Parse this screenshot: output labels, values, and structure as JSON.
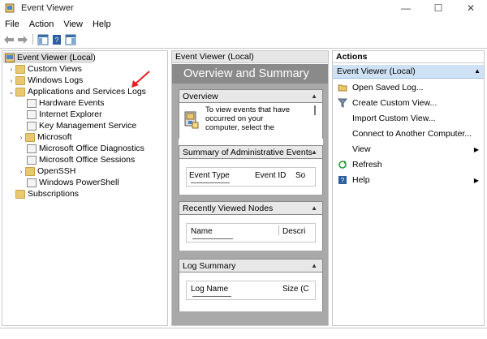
{
  "window": {
    "title": "Event Viewer",
    "minimize": "—",
    "maximize": "☐",
    "close": "✕"
  },
  "menu": [
    "File",
    "Action",
    "View",
    "Help"
  ],
  "tree": {
    "root": "Event Viewer (Local)",
    "items": [
      {
        "label": "Custom Views"
      },
      {
        "label": "Windows Logs"
      },
      {
        "label": "Applications and Services Logs"
      },
      {
        "label": "Hardware Events"
      },
      {
        "label": "Internet Explorer"
      },
      {
        "label": "Key Management Service"
      },
      {
        "label": "Microsoft"
      },
      {
        "label": "Microsoft Office Diagnostics"
      },
      {
        "label": "Microsoft Office Sessions"
      },
      {
        "label": "OpenSSH"
      },
      {
        "label": "Windows PowerShell"
      },
      {
        "label": "Subscriptions"
      }
    ]
  },
  "center": {
    "header": "Event Viewer (Local)",
    "title": "Overview and Summary",
    "overview": {
      "heading": "Overview",
      "text1": "To view events that have",
      "text2": "occurred on your",
      "text3": "computer, select the"
    },
    "admin": {
      "heading": "Summary of Administrative Events",
      "cols": [
        "Event Type",
        "Event ID",
        "So"
      ]
    },
    "recent": {
      "heading": "Recently Viewed Nodes",
      "cols": [
        "Name",
        "Descri"
      ]
    },
    "logsum": {
      "heading": "Log Summary",
      "cols": [
        "Log Name",
        "Size (C"
      ]
    }
  },
  "actions": {
    "header": "Actions",
    "group": "Event Viewer (Local)",
    "items": [
      {
        "label": "Open Saved Log..."
      },
      {
        "label": "Create Custom View..."
      },
      {
        "label": "Import Custom View..."
      },
      {
        "label": "Connect to Another Computer..."
      },
      {
        "label": "View"
      },
      {
        "label": "Refresh"
      },
      {
        "label": "Help"
      }
    ]
  }
}
